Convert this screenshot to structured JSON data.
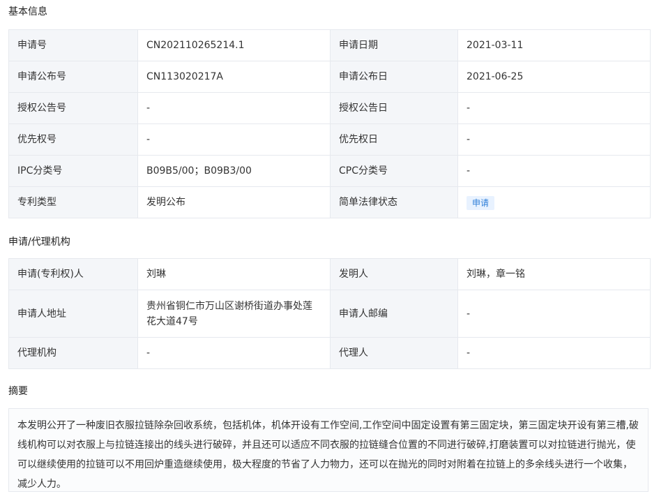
{
  "sections": {
    "basic": "基本信息",
    "agency": "申请/代理机构",
    "abstract": "摘要"
  },
  "basic_info": {
    "rows": [
      {
        "l1": "申请号",
        "v1": "CN202110265214.1",
        "l2": "申请日期",
        "v2": "2021-03-11"
      },
      {
        "l1": "申请公布号",
        "v1": "CN113020217A",
        "l2": "申请公布日",
        "v2": "2021-06-25"
      },
      {
        "l1": "授权公告号",
        "v1": "-",
        "l2": "授权公告日",
        "v2": "-"
      },
      {
        "l1": "优先权号",
        "v1": "-",
        "l2": "优先权日",
        "v2": "-"
      },
      {
        "l1": "IPC分类号",
        "v1": "B09B5/00；B09B3/00",
        "l2": "CPC分类号",
        "v2": "-"
      },
      {
        "l1": "专利类型",
        "v1": "发明公布",
        "l2": "简单法律状态",
        "v2": "申请"
      }
    ]
  },
  "agency_info": {
    "rows": [
      {
        "l1": "申请(专利权)人",
        "v1": "刘琳",
        "l2": "发明人",
        "v2": "刘琳，章一铭"
      },
      {
        "l1": "申请人地址",
        "v1": "贵州省铜仁市万山区谢桥街道办事处莲花大道47号",
        "l2": "申请人邮编",
        "v2": "-"
      },
      {
        "l1": "代理机构",
        "v1": "-",
        "l2": "代理人",
        "v2": "-"
      }
    ]
  },
  "abstract_text": "本发明公开了一种废旧衣服拉链除杂回收系统，包括机体，机体开设有工作空间,工作空间中固定设置有第三固定块，第三固定块开设有第三槽,破线机构可以对衣服上与拉链连接出的线头进行破碎，并且还可以适应不同衣服的拉链缝合位置的不同进行破碎,打磨装置可以对拉链进行抛光，使可以继续使用的拉链可以不用回炉重造继续使用，极大程度的节省了人力物力，还可以在抛光的同时对附着在拉链上的多余线头进行一个收集，减少人力。",
  "colors": {
    "label_bg": "#f4f6f9",
    "border": "#e6e9ee",
    "badge_bg": "#e8f2ff",
    "badge_text": "#2f7fd8"
  }
}
